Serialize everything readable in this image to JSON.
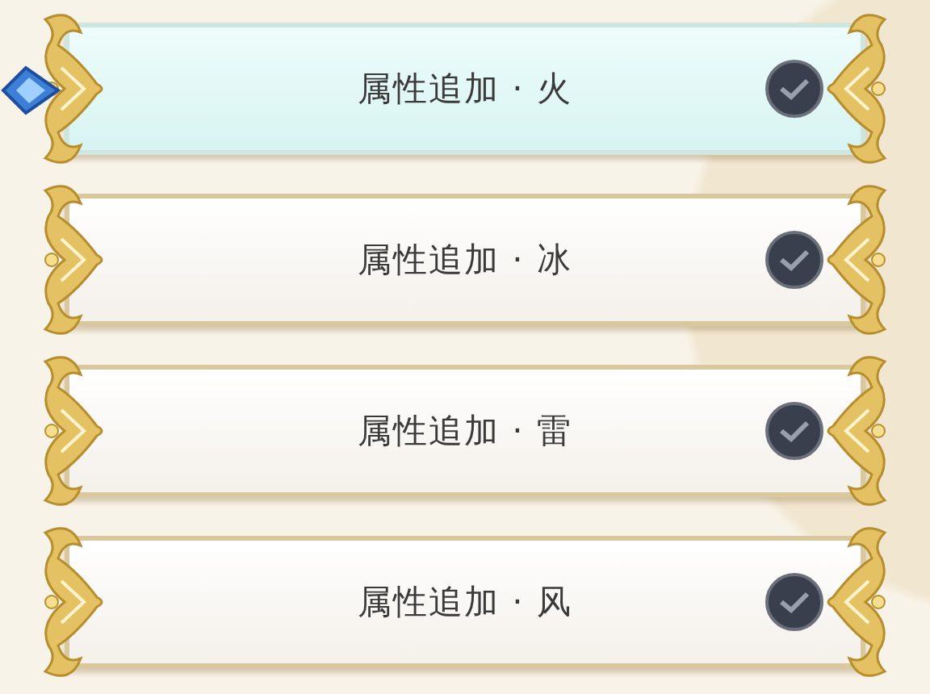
{
  "options": [
    {
      "label": "属性追加 · 火",
      "selected": true,
      "checked": true
    },
    {
      "label": "属性追加 · 冰",
      "selected": false,
      "checked": true
    },
    {
      "label": "属性追加 · 雷",
      "selected": false,
      "checked": true
    },
    {
      "label": "属性追加 · 风",
      "selected": false,
      "checked": true
    }
  ]
}
